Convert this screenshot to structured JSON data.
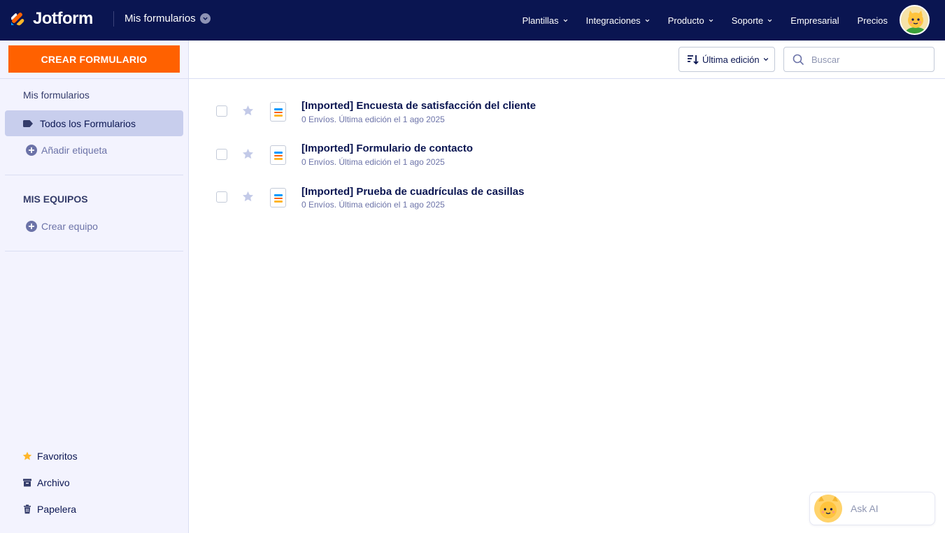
{
  "header": {
    "logo_text": "Jotform",
    "switcher_label": "Mis formularios",
    "nav": [
      {
        "label": "Plantillas",
        "has_caret": true
      },
      {
        "label": "Integraciones",
        "has_caret": true
      },
      {
        "label": "Producto",
        "has_caret": true
      },
      {
        "label": "Soporte",
        "has_caret": true
      },
      {
        "label": "Empresarial",
        "has_caret": false
      },
      {
        "label": "Precios",
        "has_caret": false
      }
    ]
  },
  "sidebar": {
    "create_button": "CREAR FORMULARIO",
    "my_forms_heading": "Mis formularios",
    "active_item": "Todos los Formularios",
    "add_label": "Añadir etiqueta",
    "teams_heading": "MIS EQUIPOS",
    "create_team": "Crear equipo",
    "bottom": {
      "favorites": "Favoritos",
      "archive": "Archivo",
      "trash": "Papelera"
    }
  },
  "toolbar": {
    "sort_label": "Última edición",
    "search_placeholder": "Buscar"
  },
  "forms": [
    {
      "title": "[Imported] Encuesta de satisfacción del cliente",
      "meta": "0 Envíos. Última edición el 1 ago 2025"
    },
    {
      "title": "[Imported] Formulario de contacto",
      "meta": "0 Envíos. Última edición el 1 ago 2025"
    },
    {
      "title": "[Imported] Prueba de cuadrículas de casillas",
      "meta": "0 Envíos. Última edición el 1 ago 2025"
    }
  ],
  "ask_ai": "Ask AI",
  "colors": {
    "navbar": "#0a1551",
    "accent": "#ff6100",
    "sidebar_bg": "#f3f3fe",
    "active_item_bg": "#c8ceed"
  }
}
